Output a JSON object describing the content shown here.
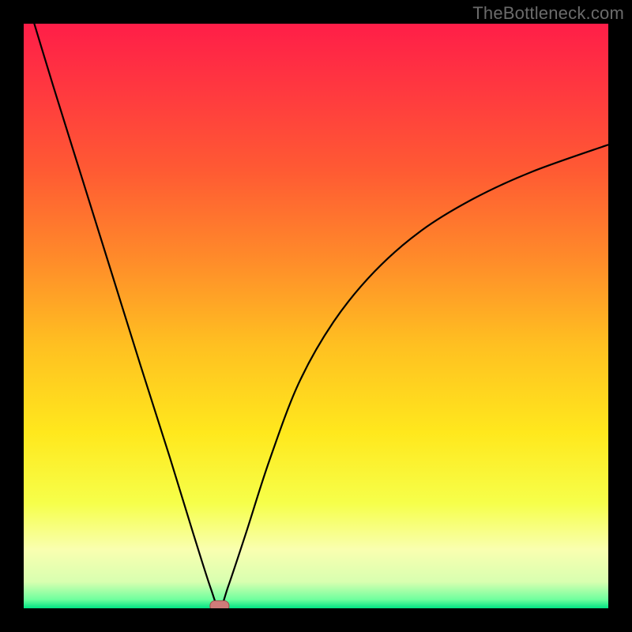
{
  "watermark": "TheBottleneck.com",
  "colors": {
    "page_bg": "#000000",
    "curve": "#000000",
    "marker_fill": "#cf7b79",
    "marker_stroke": "#9e4f4d",
    "gradient_stops": [
      {
        "offset": 0.0,
        "color": "#ff1e48"
      },
      {
        "offset": 0.12,
        "color": "#ff3a3f"
      },
      {
        "offset": 0.25,
        "color": "#ff5a33"
      },
      {
        "offset": 0.4,
        "color": "#ff8a2a"
      },
      {
        "offset": 0.55,
        "color": "#ffc021"
      },
      {
        "offset": 0.7,
        "color": "#ffe81d"
      },
      {
        "offset": 0.82,
        "color": "#f6ff4a"
      },
      {
        "offset": 0.9,
        "color": "#f9ffb0"
      },
      {
        "offset": 0.955,
        "color": "#d8ffb0"
      },
      {
        "offset": 0.985,
        "color": "#6fff9e"
      },
      {
        "offset": 1.0,
        "color": "#00e383"
      }
    ]
  },
  "chart_data": {
    "type": "line",
    "title": "",
    "xlabel": "",
    "ylabel": "",
    "xlim": [
      0,
      1
    ],
    "ylim": [
      0,
      1
    ],
    "grid": false,
    "legend": false,
    "optimum_x": 0.335,
    "series": [
      {
        "name": "bottleneck-curve",
        "x": [
          0.0,
          0.05,
          0.1,
          0.15,
          0.2,
          0.25,
          0.29,
          0.32,
          0.335,
          0.35,
          0.38,
          0.42,
          0.47,
          0.53,
          0.6,
          0.68,
          0.77,
          0.87,
          1.0
        ],
        "values": [
          1.06,
          0.895,
          0.735,
          0.575,
          0.415,
          0.258,
          0.128,
          0.034,
          0.0,
          0.038,
          0.128,
          0.252,
          0.384,
          0.49,
          0.576,
          0.646,
          0.701,
          0.747,
          0.793
        ]
      }
    ],
    "markers": [
      {
        "name": "optimum-marker",
        "x": 0.335,
        "y": 0.004,
        "shape": "rounded-rect"
      }
    ]
  }
}
